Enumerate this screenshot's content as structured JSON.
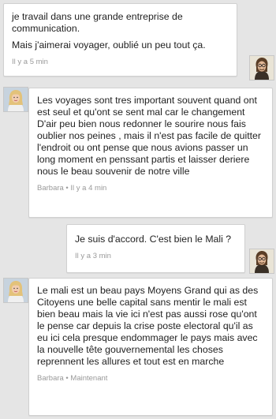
{
  "messages": [
    {
      "sender": "me",
      "lines": [
        "je travail dans une grande entreprise de communication.",
        "Mais j'aimerai voyager, oublié un peu tout ça."
      ],
      "meta": "Il y a 5 min"
    },
    {
      "sender": "Barbara",
      "text": "Les voyages sont tres important souvent quand ont est seul et qu'ont se sent mal car le changement D'air peu bien nous redonner le sourire nous fais oublier nos peines , mais il n'est pas facile de quitter l'endroit ou ont pense que nous avions passer un long moment en penssant partis et laisser deriere nous le beau souvenir de notre ville",
      "meta": "Barbara • Il y a 4 min"
    },
    {
      "sender": "me",
      "text": "Je suis d'accord. C'est bien le Mali ?",
      "meta": "Il y a 3 min"
    },
    {
      "sender": "Barbara",
      "text": "Le mali est un beau pays Moyens Grand qui as des Citoyens une belle capital sans mentir le mali est bien beau mais la vie ici n'est pas aussi rose qu'ont le pense car depuis la crise poste electoral qu'il as eu ici cela presque endommager le pays mais avec la nouvelle tête gouvernemental les choses reprennent les allures et tout est en marche",
      "meta": "Barbara • Maintenant"
    }
  ],
  "avatars": {
    "me": "man-with-glasses-avatar",
    "barbara": "blonde-woman-avatar"
  }
}
